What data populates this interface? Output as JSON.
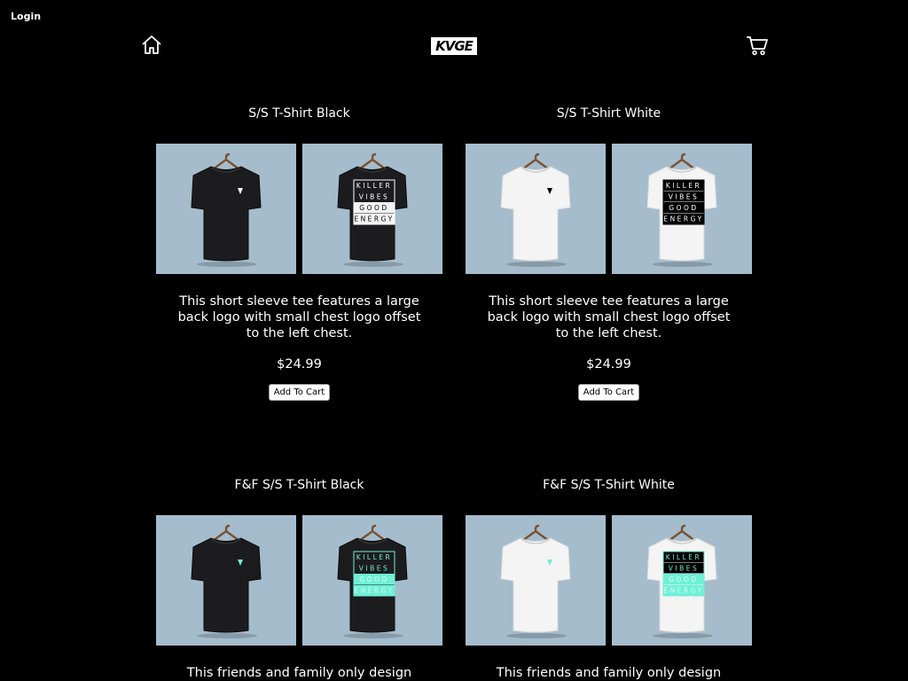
{
  "header": {
    "login": "Login",
    "logo": "KVGE",
    "home_icon": "home-icon",
    "cart_icon": "cart-icon"
  },
  "products": [
    {
      "title": "S/S T-Shirt Black",
      "description": "This short sleeve tee features a large back logo with small chest logo offset to the left chest.",
      "price": "$24.99",
      "button": "Add To Cart",
      "shirt_color": "#1c1c1e",
      "print_text": [
        "KILLER",
        "VIBES",
        "GOOD",
        "ENERGY"
      ]
    },
    {
      "title": "S/S T-Shirt White",
      "description": "This short sleeve tee features a large back logo with small chest logo offset to the left chest.",
      "price": "$24.99",
      "button": "Add To Cart",
      "shirt_color": "#f4f4f4",
      "print_text": [
        "KILLER",
        "VIBES",
        "GOOD",
        "ENERGY"
      ]
    },
    {
      "title": "F&F S/S T-Shirt Black",
      "description": "This friends and family only design",
      "shirt_color": "#1c1c1e",
      "accent": "#6ff0d6",
      "print_text": [
        "KILLER",
        "VIBES",
        "GOOD",
        "ENERGY"
      ]
    },
    {
      "title": "F&F S/S T-Shirt White",
      "description": "This friends and family only design",
      "shirt_color": "#f4f4f4",
      "accent": "#6ff0d6",
      "print_text": [
        "KILLER",
        "VIBES",
        "GOOD",
        "ENERGY"
      ]
    }
  ],
  "colors": {
    "background": "#000000",
    "photo_background": "#a5bccd"
  }
}
